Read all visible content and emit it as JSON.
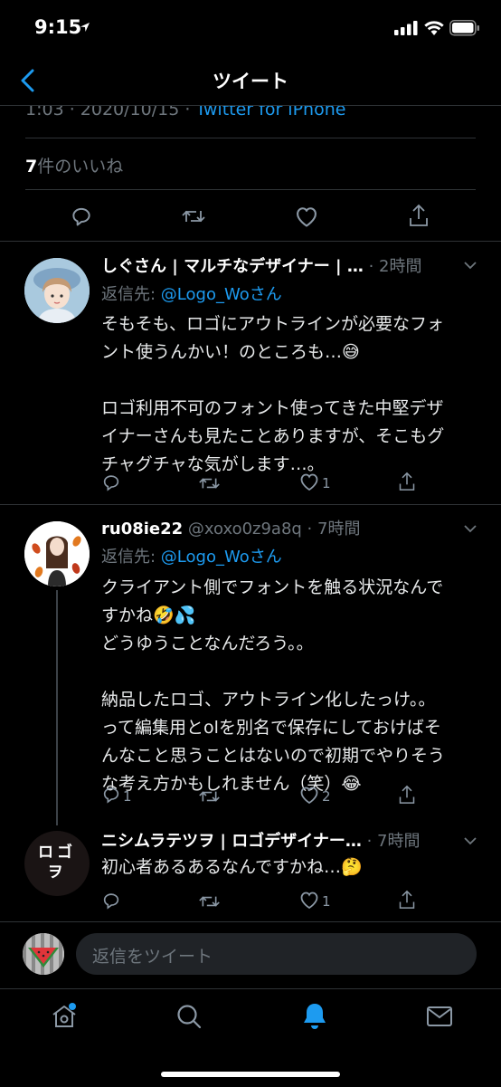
{
  "status_bar": {
    "time": "9:15"
  },
  "nav": {
    "title": "ツイート"
  },
  "detail": {
    "meta_time": "1:03 · 2020/10/15 · ",
    "meta_source": "Twitter for iPhone",
    "likes_count": "7",
    "likes_label": "件のいいね"
  },
  "replies": [
    {
      "name": "しぐさん | マルチなデザイナー | …",
      "time": "· 2時間",
      "reply_to_prefix": "返信先: ",
      "reply_to_handle": "@Logo_Woさん",
      "text": "そもそも、ロゴにアウトラインが必要なフォ\nント使うんかい！のところも…😅\n\nロゴ利用不可のフォント使ってきた中堅デザ\nイナーさんも見たことありますが、そこもグ\nチャグチャな気がします…。",
      "reply_count": "",
      "like_count": "1"
    },
    {
      "name": "ru08ie22",
      "handle_time": "@xoxo0z9a8q · 7時間",
      "reply_to_prefix": "返信先: ",
      "reply_to_handle": "@Logo_Woさん",
      "text": "クライアント側でフォントを触る状況なんで\nすかね🤣💦\nどうゆうことなんだろう。。\n\n納品したロゴ、アウトライン化したっけ。。\nって編集用とolを別名で保存にしておけばそ\nんなこと思うことはないので初期でやりそう\nな考え方かもしれません（笑）😂",
      "reply_count": "1",
      "like_count": "2"
    },
    {
      "name": "ニシムラテツヲ | ロゴデザイナー…",
      "time": "· 7時間",
      "avatar_text": "ロゴ\nヲ",
      "text": "初心者あるあるなんですかね…🤔",
      "reply_count": "",
      "like_count": "1"
    }
  ],
  "composer": {
    "placeholder": "返信をツイート"
  },
  "tabbar": {
    "items": [
      "home-icon",
      "search-icon",
      "notifications-icon",
      "messages-icon"
    ]
  },
  "colors": {
    "accent": "#1d9bf0",
    "background": "#000000",
    "divider": "#2f3336"
  }
}
